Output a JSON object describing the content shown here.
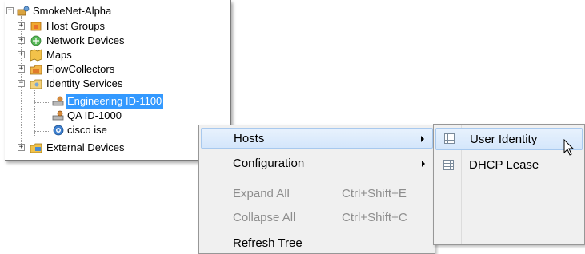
{
  "tree": {
    "root": "SmokeNet-Alpha",
    "items": [
      {
        "label": "Host Groups",
        "icon": "host-groups-icon"
      },
      {
        "label": "Network Devices",
        "icon": "network-devices-icon"
      },
      {
        "label": "Maps",
        "icon": "maps-icon"
      },
      {
        "label": "FlowCollectors",
        "icon": "flow-collectors-icon"
      },
      {
        "label": "Identity Services",
        "icon": "identity-services-icon"
      },
      {
        "label": "External Devices",
        "icon": "external-devices-icon"
      }
    ],
    "identity_children": [
      {
        "label": "Engineering ID-1100",
        "selected": true
      },
      {
        "label": "QA ID-1000",
        "selected": false
      },
      {
        "label": "cisco ise",
        "selected": false
      }
    ]
  },
  "context_menu": {
    "items": [
      {
        "label": "Hosts",
        "shortcut": "",
        "submenu": true,
        "disabled": false,
        "highlighted": true
      },
      {
        "label": "Configuration",
        "shortcut": "",
        "submenu": true,
        "disabled": false,
        "highlighted": false
      },
      {
        "label": "Expand All",
        "shortcut": "Ctrl+Shift+E",
        "submenu": false,
        "disabled": true,
        "highlighted": false
      },
      {
        "label": "Collapse All",
        "shortcut": "Ctrl+Shift+C",
        "submenu": false,
        "disabled": true,
        "highlighted": false
      },
      {
        "label": "Refresh Tree",
        "shortcut": "",
        "submenu": false,
        "disabled": false,
        "highlighted": false
      }
    ]
  },
  "hosts_submenu": {
    "items": [
      {
        "label": "User Identity",
        "highlighted": true
      },
      {
        "label": "DHCP Lease",
        "highlighted": false
      }
    ]
  },
  "colors": {
    "selection": "#3399ff",
    "menu_highlight": "#d4e6fb",
    "menu_background": "#f0f0f0"
  }
}
